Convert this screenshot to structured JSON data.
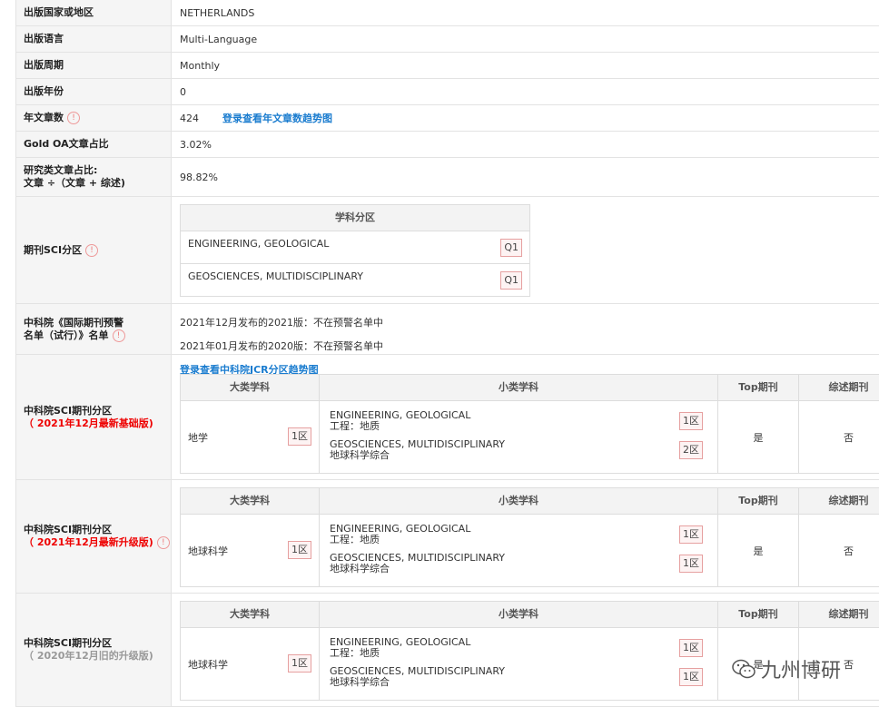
{
  "rows": {
    "country": {
      "label": "出版国家或地区",
      "value": "NETHERLANDS"
    },
    "language": {
      "label": "出版语言",
      "value": "Multi-Language"
    },
    "frequency": {
      "label": "出版周期",
      "value": "Monthly"
    },
    "year": {
      "label": "出版年份",
      "value": "0"
    },
    "articles": {
      "label": "年文章数",
      "value": "424",
      "link": "登录查看年文章数趋势图"
    },
    "gold_oa": {
      "label": "Gold OA文章占比",
      "value": "3.02%"
    },
    "research_ratio": {
      "label1": "研究类文章占比:",
      "label2": "文章 ÷（文章 + 综述)",
      "value": "98.82%"
    },
    "sci_zone": {
      "label": "期刊SCI分区",
      "header": "学科分区",
      "items": [
        {
          "name": "ENGINEERING, GEOLOGICAL",
          "q": "Q1"
        },
        {
          "name": "GEOSCIENCES, MULTIDISCIPLINARY",
          "q": "Q1"
        }
      ]
    },
    "warning": {
      "label1": "中科院《国际期刊预警",
      "label2": "名单（试行）》名单",
      "line1": "2021年12月发布的2021版：不在预警名单中",
      "line2": "2021年01月发布的2020版：不在预警名单中"
    }
  },
  "jcr_link": "登录查看中科院JCR分区趋势图",
  "zone_headers": {
    "major": "大类学科",
    "minor": "小类学科",
    "top": "Top期刊",
    "review": "综述期刊"
  },
  "zones": [
    {
      "title": "中科院SCI期刊分区",
      "subtitle": "（ 2021年12月最新基础版)",
      "style": "red",
      "icon": false,
      "major": "地学",
      "major_zone": "1区",
      "minors": [
        {
          "en": "ENGINEERING, GEOLOGICAL",
          "cn": "工程：地质",
          "zone": "1区"
        },
        {
          "en": "GEOSCIENCES, MULTIDISCIPLINARY",
          "cn": "地球科学综合",
          "zone": "2区"
        }
      ],
      "top": "是",
      "review": "否"
    },
    {
      "title": "中科院SCI期刊分区",
      "subtitle": "（ 2021年12月最新升级版)",
      "style": "red",
      "icon": true,
      "major": "地球科学",
      "major_zone": "1区",
      "minors": [
        {
          "en": "ENGINEERING, GEOLOGICAL",
          "cn": "工程：地质",
          "zone": "1区"
        },
        {
          "en": "GEOSCIENCES, MULTIDISCIPLINARY",
          "cn": "地球科学综合",
          "zone": "1区"
        }
      ],
      "top": "是",
      "review": "否"
    },
    {
      "title": "中科院SCI期刊分区",
      "subtitle": "（ 2020年12月旧的升级版)",
      "style": "grey",
      "icon": false,
      "major": "地球科学",
      "major_zone": "1区",
      "minors": [
        {
          "en": "ENGINEERING, GEOLOGICAL",
          "cn": "工程：地质",
          "zone": "1区"
        },
        {
          "en": "GEOSCIENCES, MULTIDISCIPLINARY",
          "cn": "地球科学综合",
          "zone": "1区"
        }
      ],
      "top": "是",
      "review": "否"
    }
  ],
  "watermark": "九州博研",
  "colors": {
    "accent": "#1a7ccf",
    "warn": "#e00000",
    "badge_border": "#e6a0a0"
  }
}
